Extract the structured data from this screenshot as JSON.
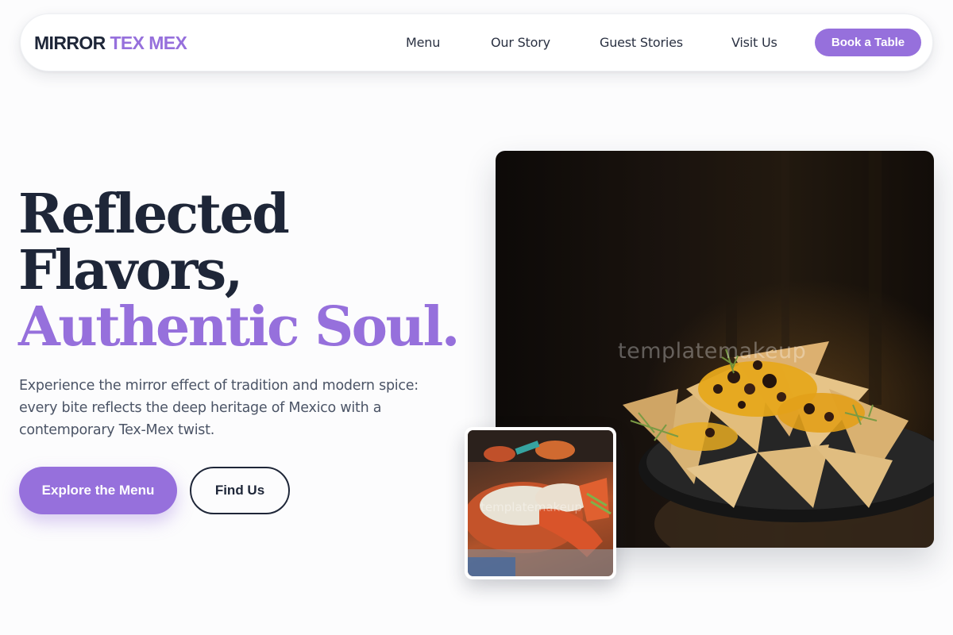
{
  "brand": {
    "part1": "MIRROR",
    "part2": "TEX MEX"
  },
  "nav": {
    "links": [
      {
        "label": "Menu"
      },
      {
        "label": "Our Story"
      },
      {
        "label": "Guest Stories"
      },
      {
        "label": "Visit Us"
      }
    ],
    "cta_label": "Book a Table"
  },
  "hero": {
    "headline_line1": "Reflected",
    "headline_line2": "Flavors,",
    "headline_line3": "Authentic Soul.",
    "lead": "Experience the mirror effect of tradition and modern spice: every bite reflects the deep heritage of Mexico with a contemporary Tex-Mex twist.",
    "primary_button": "Explore the Menu",
    "secondary_button": "Find Us"
  },
  "images": {
    "main_watermark": "templatemakeup",
    "thumb_watermark": "templatemakeup"
  },
  "colors": {
    "accent": "#9670dc",
    "dark": "#1e2638",
    "body_text": "#4b5466",
    "background": "#fcfcfd"
  }
}
